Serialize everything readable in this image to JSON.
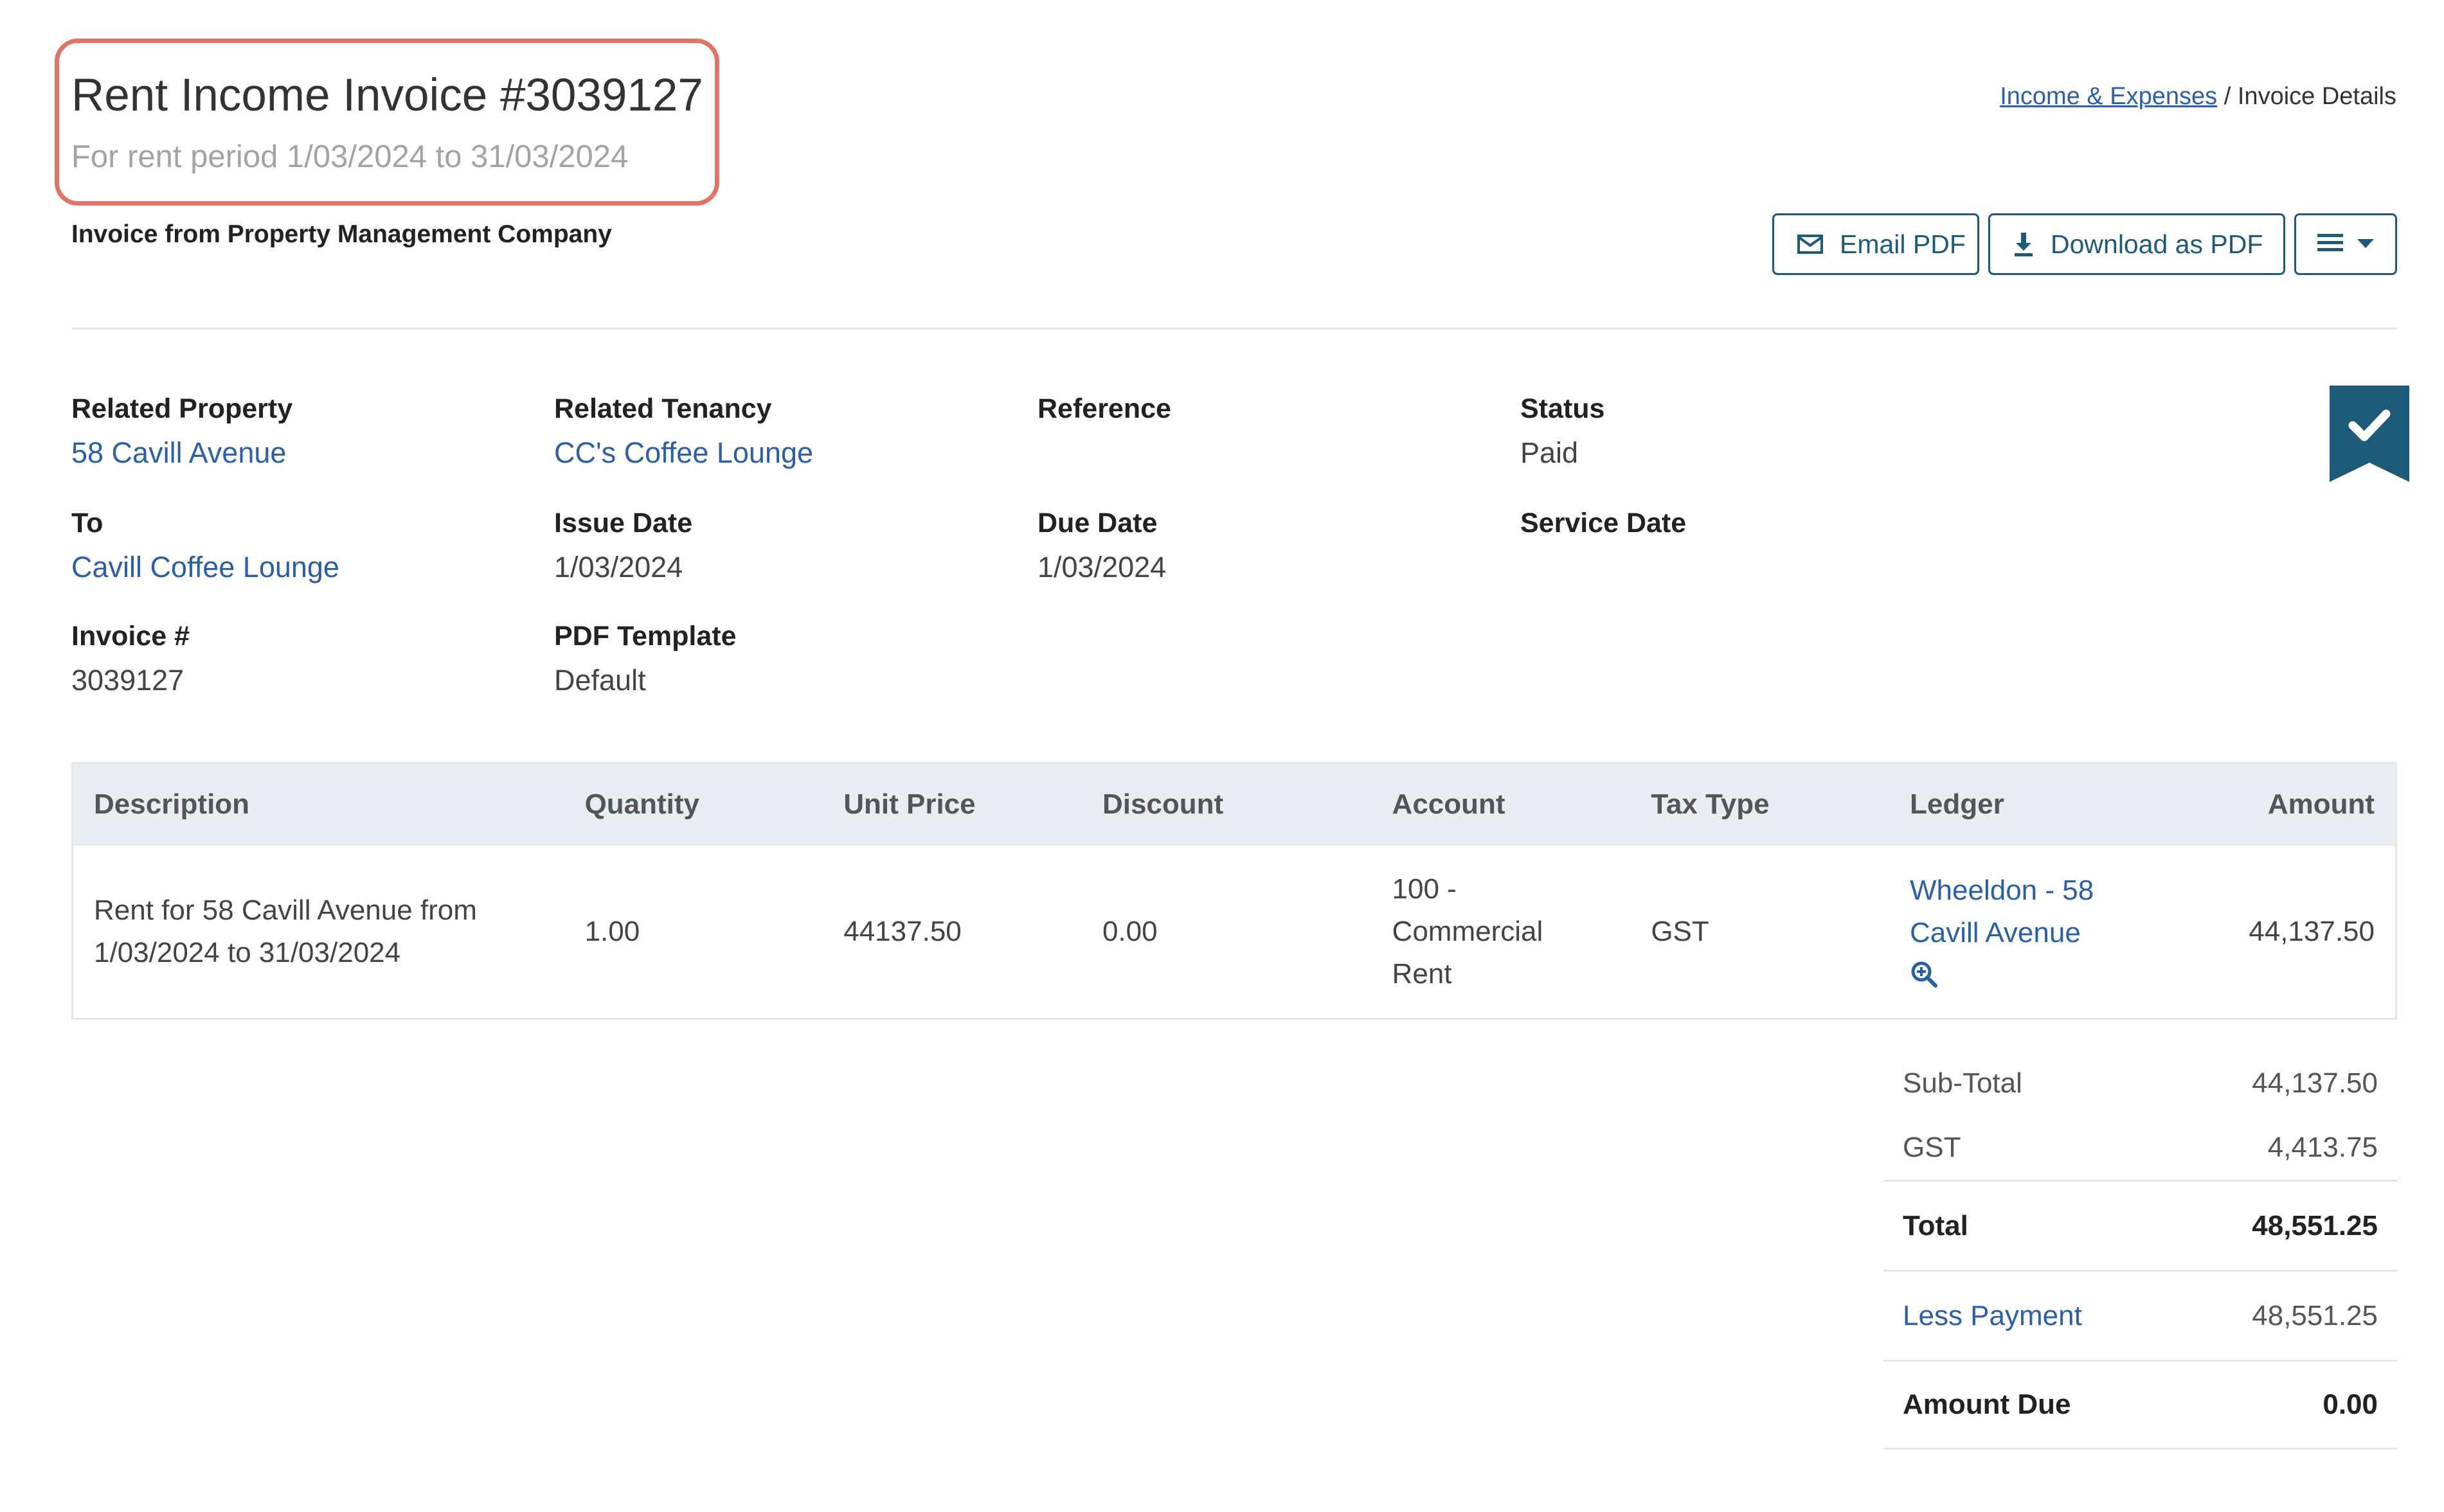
{
  "header": {
    "title": "Rent Income Invoice #3039127",
    "subtitle": "For rent period 1/03/2024 to 31/03/2024",
    "from_line": "Invoice from Property Management Company"
  },
  "breadcrumb": {
    "parent": "Income & Expenses",
    "separator": " / ",
    "current": "Invoice Details"
  },
  "toolbar": {
    "email_label": "Email PDF",
    "download_label": "Download as PDF"
  },
  "details": {
    "related_property": {
      "label": "Related Property",
      "value": "58 Cavill Avenue"
    },
    "related_tenancy": {
      "label": "Related Tenancy",
      "value": "CC's Coffee Lounge"
    },
    "reference": {
      "label": "Reference",
      "value": ""
    },
    "status": {
      "label": "Status",
      "value": "Paid"
    },
    "to": {
      "label": "To",
      "value": "Cavill Coffee Lounge"
    },
    "issue_date": {
      "label": "Issue Date",
      "value": "1/03/2024"
    },
    "due_date": {
      "label": "Due Date",
      "value": "1/03/2024"
    },
    "service_date": {
      "label": "Service Date",
      "value": ""
    },
    "invoice_no": {
      "label": "Invoice #",
      "value": "3039127"
    },
    "pdf_template": {
      "label": "PDF Template",
      "value": "Default"
    }
  },
  "table": {
    "columns": [
      "Description",
      "Quantity",
      "Unit Price",
      "Discount",
      "Account",
      "Tax Type",
      "Ledger",
      "Amount"
    ],
    "rows": [
      {
        "description_line1": "Rent for 58 Cavill Avenue from",
        "description_line2": "1/03/2024 to 31/03/2024",
        "quantity": "1.00",
        "unit_price": "44137.50",
        "discount": "0.00",
        "account_line1": "100 -",
        "account_line2": "Commercial",
        "account_line3": "Rent",
        "tax_type": "GST",
        "ledger_line1": "Wheeldon - 58",
        "ledger_line2": "Cavill Avenue",
        "ledger_icon": "zoom-in-icon",
        "amount": "44,137.50"
      }
    ]
  },
  "totals": {
    "subtotal_label": "Sub-Total",
    "subtotal": "44,137.50",
    "gst_label": "GST",
    "gst": "4,413.75",
    "total_label": "Total",
    "total": "48,551.25",
    "payment_label": "Less Payment",
    "payment": "48,551.25",
    "amount_due_label": "Amount Due",
    "amount_due": "0.00"
  },
  "colors": {
    "accent": "#1d5a78",
    "link": "#2b5fa8",
    "highlight": "#e07466",
    "table_header_bg": "#e8edf3"
  },
  "icons": {
    "email": "envelope-icon",
    "download": "download-icon",
    "menu": "hamburger-menu-icon",
    "dropdown": "caret-down-icon",
    "status": "paid-check-ribbon-icon"
  }
}
